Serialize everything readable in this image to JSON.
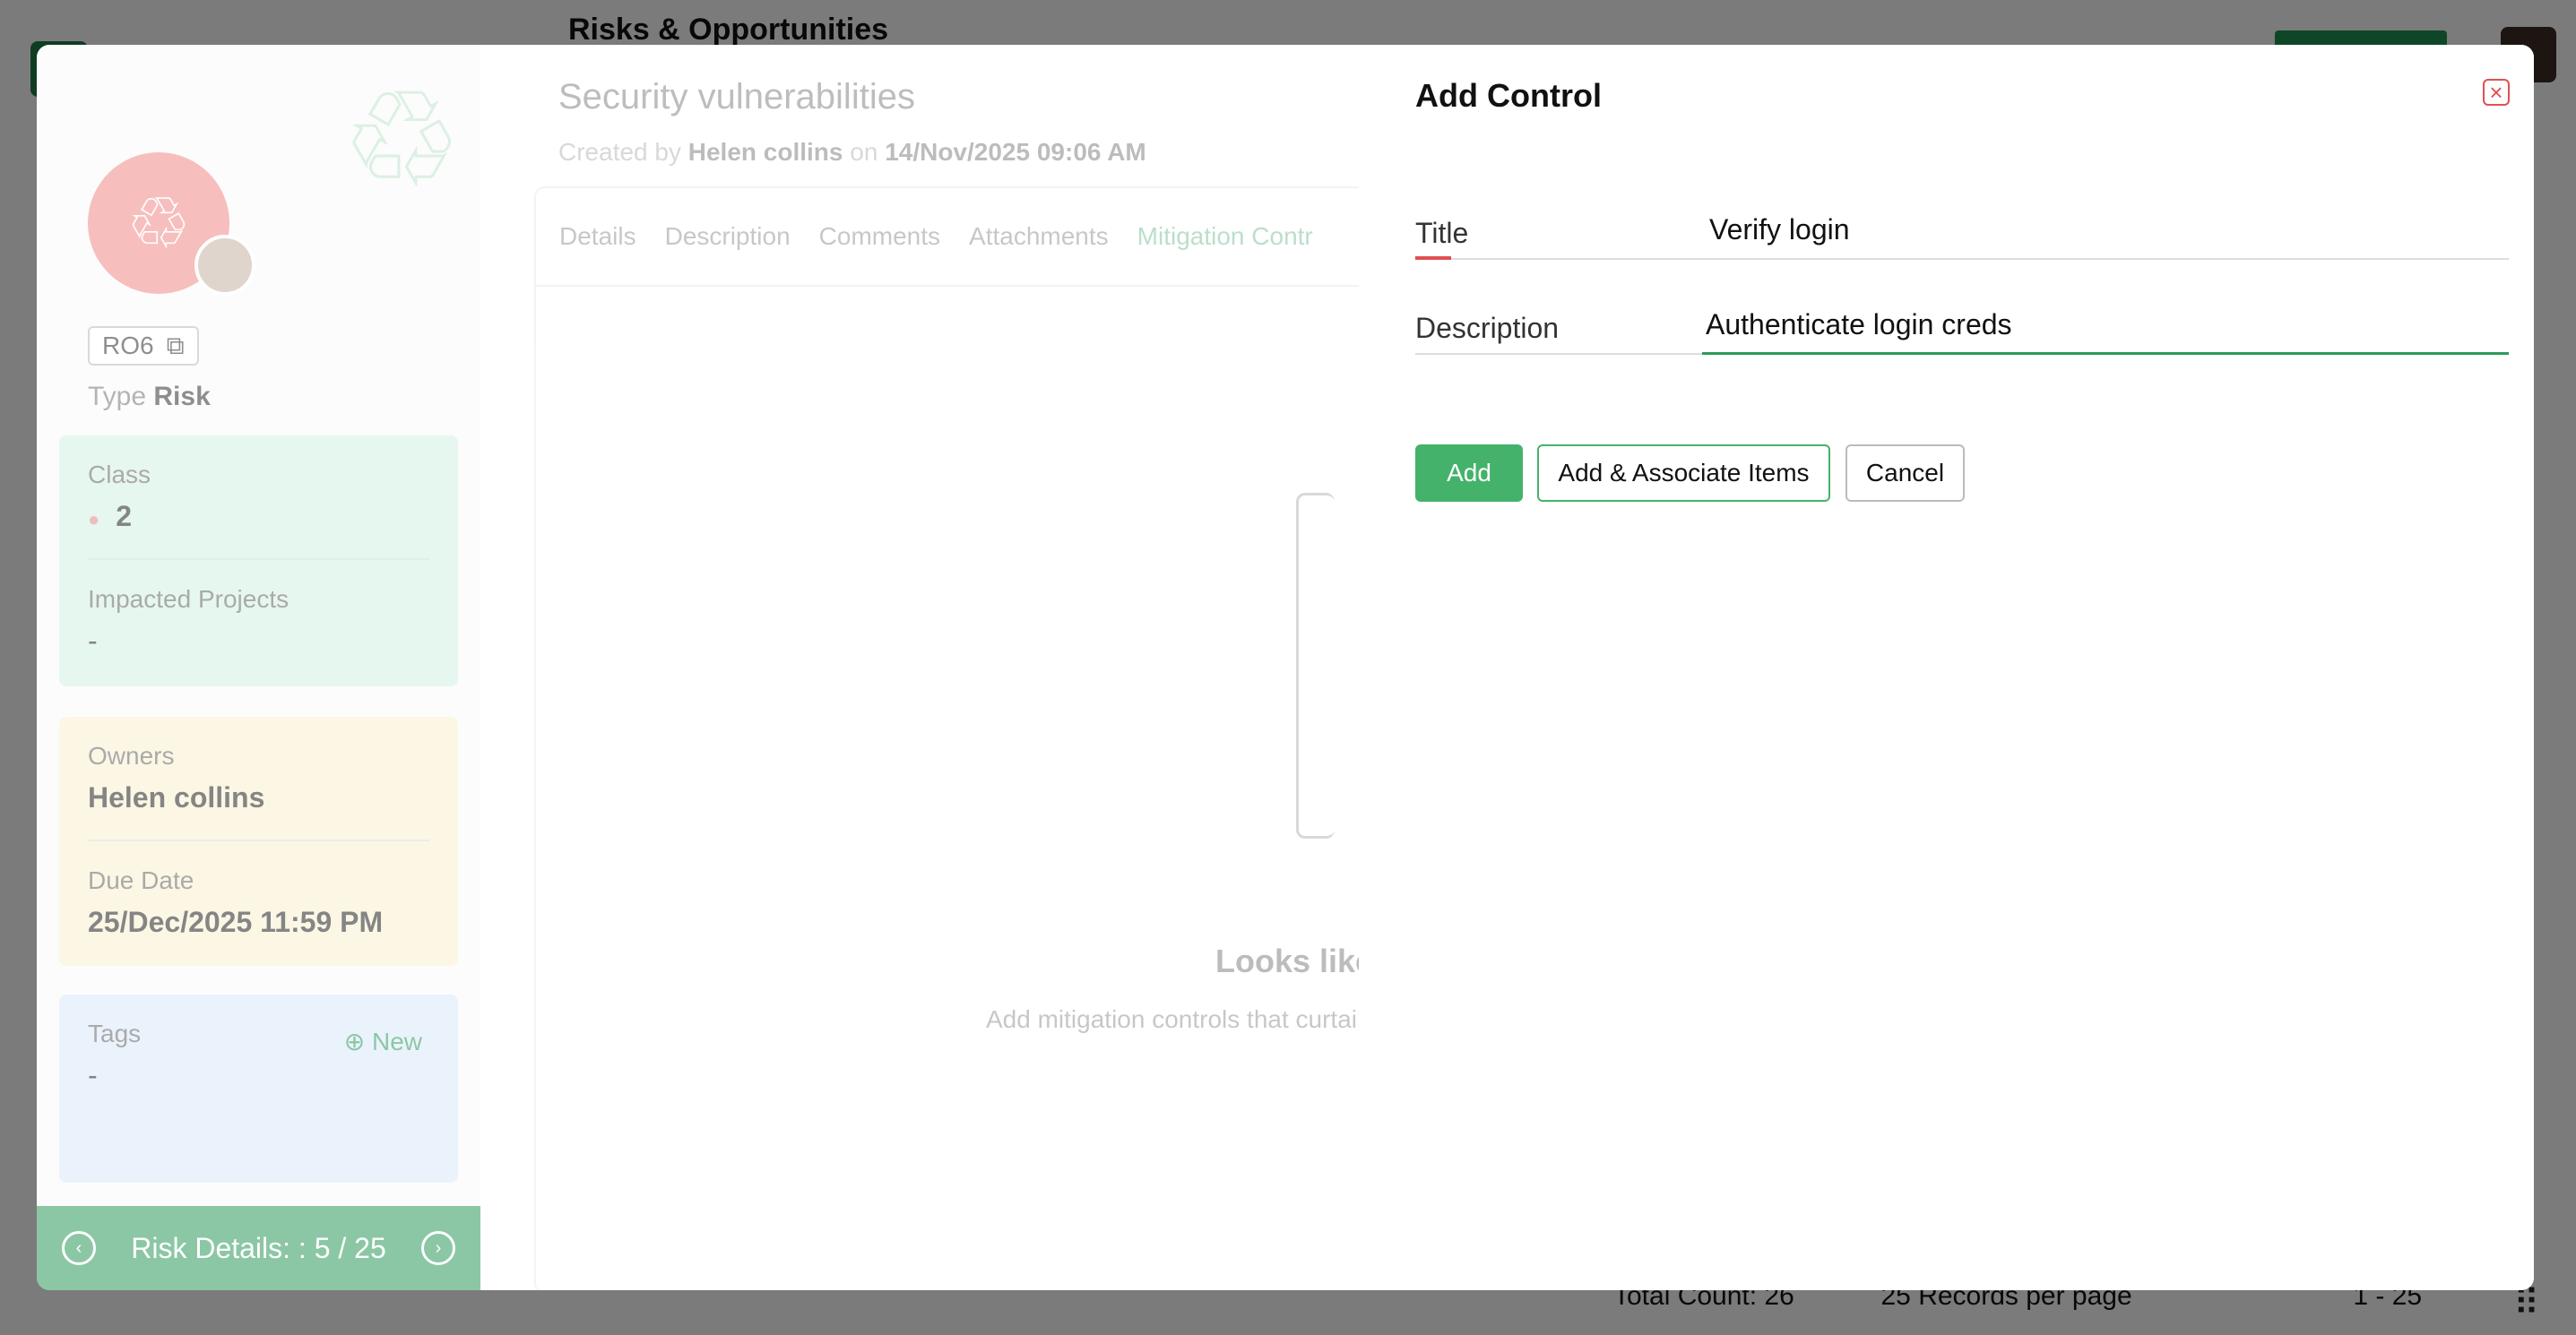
{
  "background": {
    "page_title": "Risks & Opportunities",
    "footer": {
      "total_count": "Total Count: 26",
      "records_per_page": "25 Records per page",
      "range": "1 - 25"
    }
  },
  "left_panel": {
    "record_id": "RO6",
    "type_label": "Type",
    "type_value": "Risk",
    "class_label": "Class",
    "class_value": "2",
    "impacted_projects_label": "Impacted Projects",
    "impacted_projects_value": "-",
    "owners_label": "Owners",
    "owners_value": "Helen collins",
    "due_date_label": "Due Date",
    "due_date_value": "25/Dec/2025 11:59 PM",
    "tags_label": "Tags",
    "tags_new": "New",
    "tags_value": "-",
    "footer_label": "Risk Details: : 5 / 25"
  },
  "middle_panel": {
    "title": "Security vulnerabilities",
    "created_by_prefix": "Created by",
    "created_by": "Helen collins",
    "on": "on",
    "created_on": "14/Nov/2025 09:06 AM",
    "tabs": [
      "Details",
      "Description",
      "Comments",
      "Attachments",
      "Mitigation Contr"
    ],
    "empty_title": "Looks like",
    "empty_sub": "Add mitigation controls that curtail i"
  },
  "add_control": {
    "title": "Add Control",
    "title_label": "Title",
    "title_value": "Verify login",
    "description_label": "Description",
    "description_value": "Authenticate login creds",
    "add_button": "Add",
    "add_associate_button": "Add & Associate Items",
    "cancel_button": "Cancel"
  },
  "colors": {
    "accent_green": "#45b26b",
    "close_red": "#e05050"
  }
}
